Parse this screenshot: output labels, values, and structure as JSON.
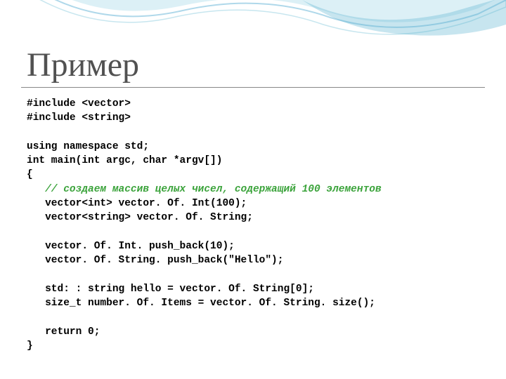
{
  "slide": {
    "title": "Пример",
    "code": {
      "l1": "#include <vector>",
      "l2": "#include <string>",
      "l3": "",
      "l4": "using namespace std;",
      "l5": "int main(int argc, char *argv[])",
      "l6": "{",
      "l7_pre": "   ",
      "l7_comment": "// создаем массив целых чисел, содержащий 100 элементов",
      "l8": "   vector<int> vector. Of. Int(100);",
      "l9": "   vector<string> vector. Of. String;",
      "l10": "",
      "l11": "   vector. Of. Int. push_back(10);",
      "l12": "   vector. Of. String. push_back(\"Hello\");",
      "l13": "",
      "l14": "   std: : string hello = vector. Of. String[0];",
      "l15": "   size_t number. Of. Items = vector. Of. String. size();",
      "l16": "",
      "l17": "   return 0;",
      "l18": "}"
    }
  }
}
